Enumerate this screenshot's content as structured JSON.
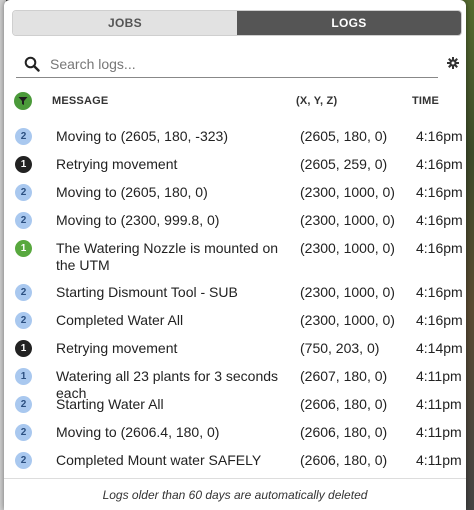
{
  "tabs": [
    {
      "label": "JOBS",
      "active": false
    },
    {
      "label": "LOGS",
      "active": true
    }
  ],
  "search": {
    "placeholder": "Search logs...",
    "value": ""
  },
  "table": {
    "headers": {
      "message": "MESSAGE",
      "xyz": "(X, Y, Z)",
      "time": "TIME"
    },
    "rows": [
      {
        "verbosity": "2",
        "kind": "info",
        "message": "Moving to (2605, 180, -323)",
        "xyz": "(2605, 180, 0)",
        "time": "4:16pm"
      },
      {
        "verbosity": "1",
        "kind": "busy",
        "message": "Retrying movement",
        "xyz": "(2605, 259, 0)",
        "time": "4:16pm"
      },
      {
        "verbosity": "2",
        "kind": "info",
        "message": "Moving to (2605, 180, 0)",
        "xyz": "(2300, 1000, 0)",
        "time": "4:16pm"
      },
      {
        "verbosity": "2",
        "kind": "info",
        "message": "Moving to (2300, 999.8, 0)",
        "xyz": "(2300, 1000, 0)",
        "time": "4:16pm"
      },
      {
        "verbosity": "1",
        "kind": "success",
        "message": "The Watering Nozzle is mounted on the UTM",
        "xyz": "(2300, 1000, 0)",
        "time": "4:16pm"
      },
      {
        "verbosity": "2",
        "kind": "info",
        "message": "Starting Dismount Tool - SUB",
        "xyz": "(2300, 1000, 0)",
        "time": "4:16pm"
      },
      {
        "verbosity": "2",
        "kind": "info",
        "message": "Completed Water All",
        "xyz": "(2300, 1000, 0)",
        "time": "4:16pm"
      },
      {
        "verbosity": "1",
        "kind": "busy",
        "message": "Retrying movement",
        "xyz": "(750, 203, 0)",
        "time": "4:14pm"
      },
      {
        "verbosity": "1",
        "kind": "info",
        "message": "Watering all 23 plants for 3 seconds each",
        "xyz": "(2607, 180, 0)",
        "time": "4:11pm"
      },
      {
        "verbosity": "2",
        "kind": "info",
        "message": "Starting Water All",
        "xyz": "(2606, 180, 0)",
        "time": "4:11pm"
      },
      {
        "verbosity": "2",
        "kind": "info",
        "message": "Moving to (2606.4, 180, 0)",
        "xyz": "(2606, 180, 0)",
        "time": "4:11pm"
      },
      {
        "verbosity": "2",
        "kind": "info",
        "message": "Completed Mount water SAFELY",
        "xyz": "(2606, 180, 0)",
        "time": "4:11pm"
      }
    ]
  },
  "footer": {
    "text": "Logs older than 60 days are automatically deleted"
  },
  "colors": {
    "info": "#a9c8ef",
    "busy": "#222222",
    "success": "#58a83e",
    "active_tab": "#555555"
  },
  "icons": {
    "search": "search-icon",
    "settings": "gear-icon",
    "filter": "filter-icon"
  }
}
